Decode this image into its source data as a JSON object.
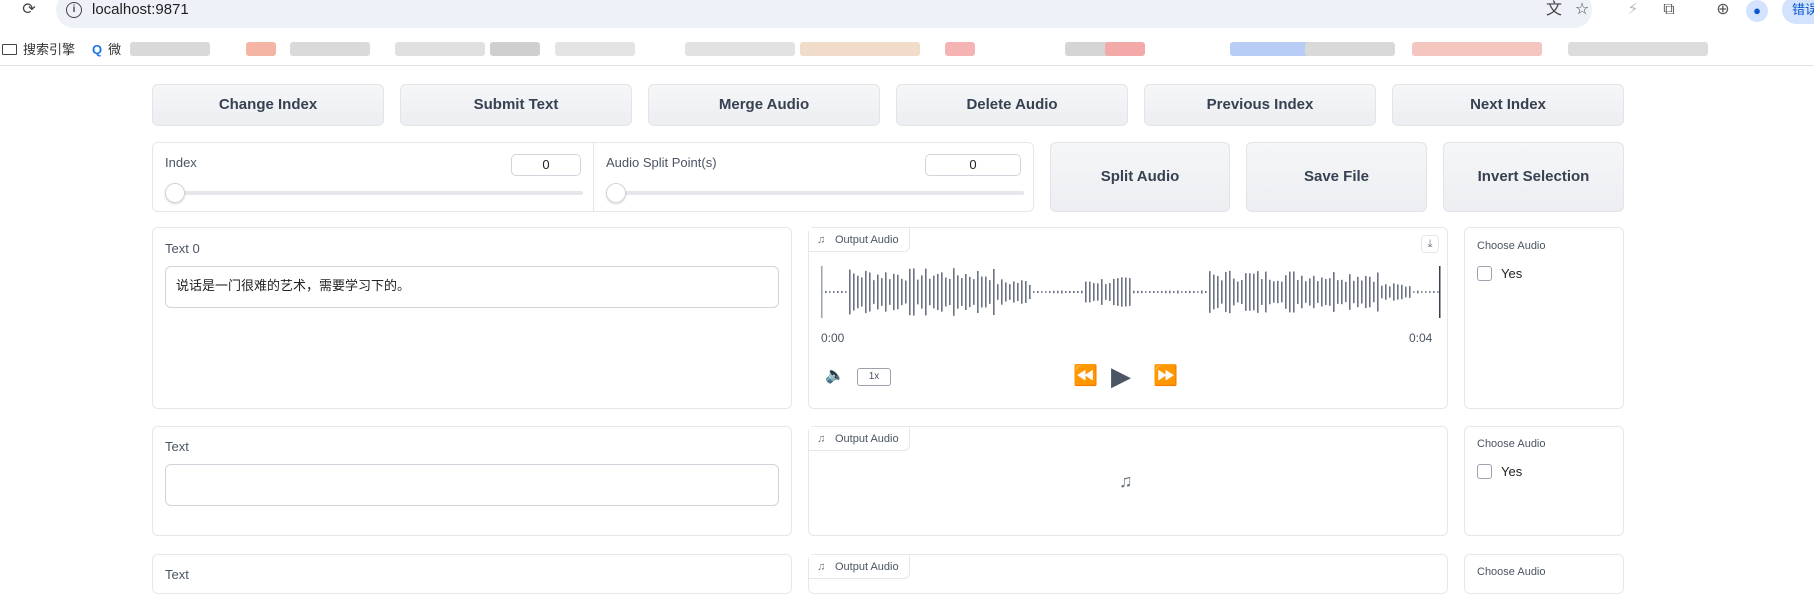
{
  "browser": {
    "url": "localhost:9871",
    "profile_label": "错误",
    "bookmarks": [
      {
        "label": "搜索引擎"
      },
      {
        "label": "微"
      }
    ]
  },
  "toolbar": {
    "change_index": "Change Index",
    "submit_text": "Submit Text",
    "merge_audio": "Merge Audio",
    "delete_audio": "Delete Audio",
    "previous_index": "Previous Index",
    "next_index": "Next Index"
  },
  "controls": {
    "index_label": "Index",
    "index_value": "0",
    "split_label": "Audio Split Point(s)",
    "split_value": "0",
    "split_audio": "Split Audio",
    "save_file": "Save File",
    "invert_selection": "Invert Selection"
  },
  "rows": [
    {
      "text_label": "Text 0",
      "text_value": "说话是一门很难的艺术，需要学习下的。",
      "audio_label": "Output Audio",
      "time_start": "0:00",
      "time_end": "0:04",
      "speed": "1x",
      "choose_label": "Choose Audio",
      "choose_option": "Yes"
    },
    {
      "text_label": "Text",
      "text_value": "",
      "audio_label": "Output Audio",
      "choose_label": "Choose Audio",
      "choose_option": "Yes"
    },
    {
      "text_label": "Text",
      "audio_label": "Output Audio",
      "choose_label": "Choose Audio"
    }
  ],
  "colors": {
    "button_bg": "#eceef1",
    "waveform": "#6b7280",
    "profile": "#d3e3fd"
  }
}
